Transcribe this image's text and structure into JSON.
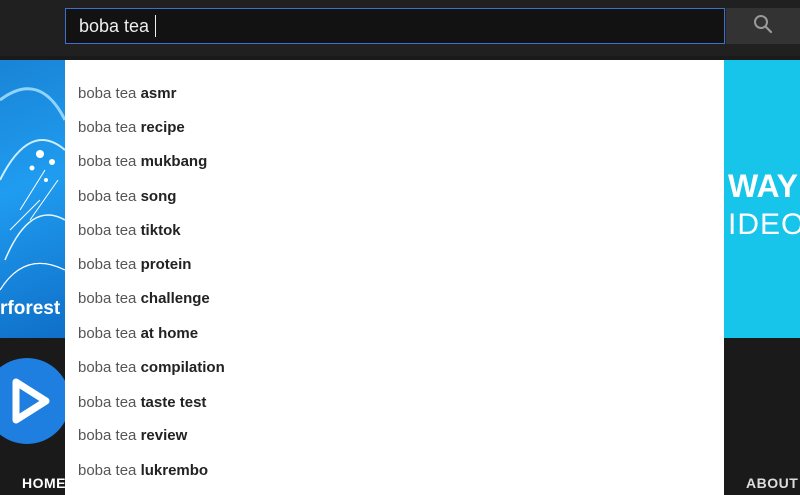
{
  "search": {
    "query": "boba tea",
    "icon": "search-icon"
  },
  "suggestions": [
    {
      "prefix": "boba tea",
      "completion": "asmr"
    },
    {
      "prefix": "boba tea",
      "completion": "recipe"
    },
    {
      "prefix": "boba tea",
      "completion": "mukbang"
    },
    {
      "prefix": "boba tea",
      "completion": "song"
    },
    {
      "prefix": "boba tea",
      "completion": "tiktok"
    },
    {
      "prefix": "boba tea",
      "completion": "protein"
    },
    {
      "prefix": "boba tea",
      "completion": "challenge"
    },
    {
      "prefix": "boba tea",
      "completion": "at home"
    },
    {
      "prefix": "boba tea",
      "completion": "compilation"
    },
    {
      "prefix": "boba tea",
      "completion": "taste test"
    },
    {
      "prefix": "boba tea",
      "completion": "review"
    },
    {
      "prefix": "boba tea",
      "completion": "lukrembo"
    }
  ],
  "banner": {
    "left_text": "rforest",
    "right_line1": "WAY T",
    "right_line2": "IDEOS"
  },
  "channel_nav": {
    "home": "HOME",
    "about": "ABOUT"
  },
  "colors": {
    "accent": "#3d6fd0",
    "banner_blue": "#1f9cf0",
    "banner_cyan": "#18c5ea"
  }
}
